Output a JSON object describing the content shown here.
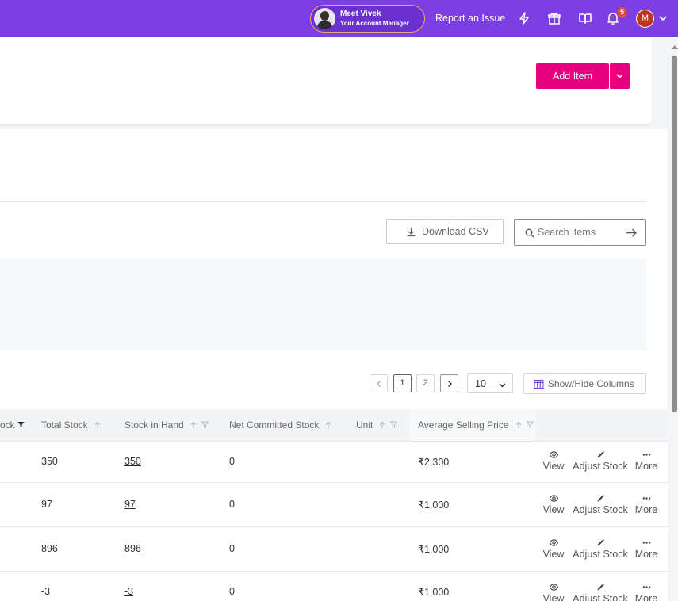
{
  "topbar": {
    "manager_name": "Meet Vivek",
    "manager_role": "Your Account Manager",
    "report_label": "Report an Issue",
    "notification_count": "5",
    "user_initial": "M",
    "bg_color": "#7b3fe4"
  },
  "header": {
    "add_item_label": "Add Item",
    "accent_color": "#e6007e"
  },
  "toolbar": {
    "download_csv_label": "Download CSV",
    "search_placeholder": "Search items",
    "search_value": ""
  },
  "pagination": {
    "pages": [
      "1",
      "2"
    ],
    "current_page": "1",
    "per_page": "10",
    "show_hide_label": "Show/Hide Columns"
  },
  "table": {
    "columns": {
      "stock_partial": "ock",
      "total_stock": "Total Stock",
      "stock_in_hand": "Stock in Hand",
      "net_committed": "Net Committed Stock",
      "unit": "Unit",
      "avg_price": "Average Selling Price"
    },
    "rows": [
      {
        "total": "350",
        "in_hand": "350",
        "committed": "0",
        "unit": "",
        "price": "₹2,300"
      },
      {
        "total": "97",
        "in_hand": "97",
        "committed": "0",
        "unit": "",
        "price": "₹1,000"
      },
      {
        "total": "896",
        "in_hand": "896",
        "committed": "0",
        "unit": "",
        "price": "₹1,000"
      },
      {
        "total": "-3",
        "in_hand": "-3",
        "committed": "0",
        "unit": "",
        "price": "₹1,000"
      }
    ],
    "actions": {
      "view": "View",
      "adjust": "Adjust Stock",
      "more": "More"
    }
  },
  "icons": {
    "lightning": "lightning-icon",
    "gift": "gift-icon",
    "book": "book-icon",
    "bell": "bell-icon",
    "eye": "eye-icon",
    "pencil": "pencil-icon",
    "dots": "more-dots-icon"
  }
}
